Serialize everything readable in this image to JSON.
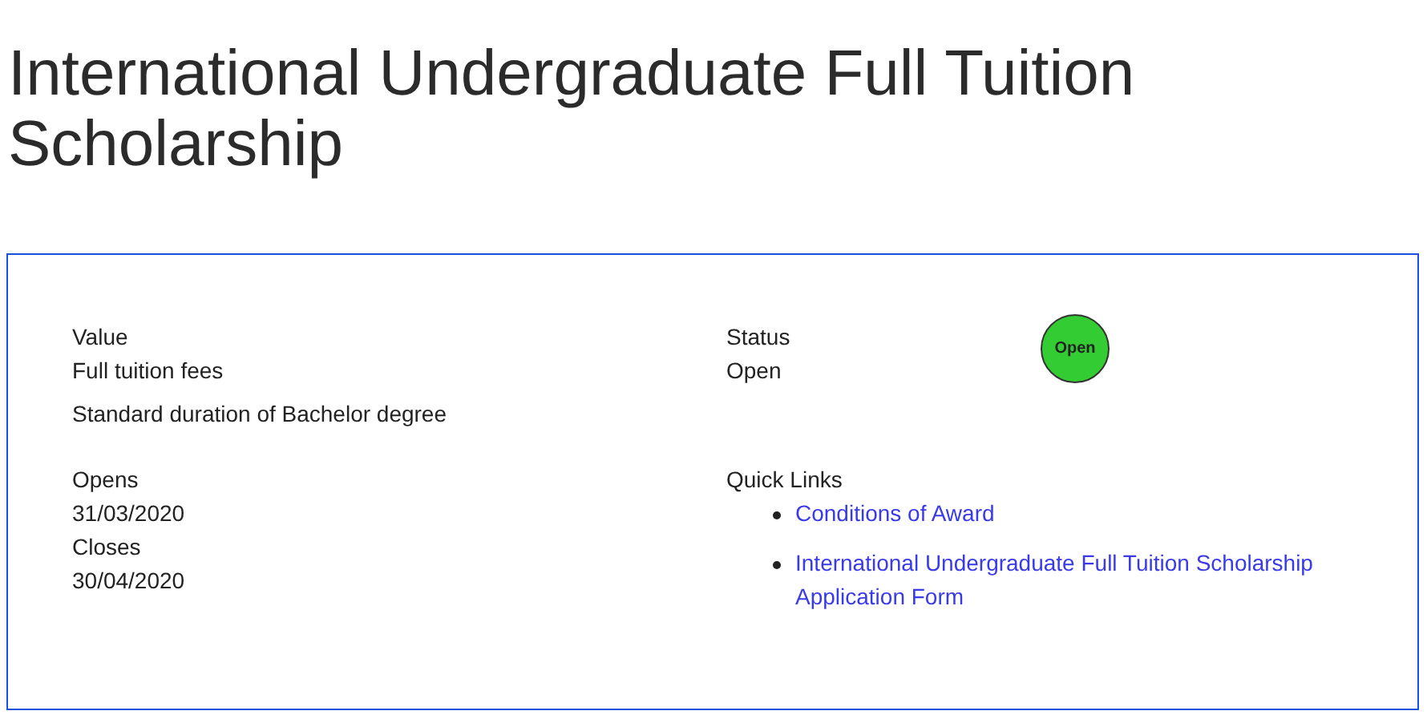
{
  "title": "International Undergraduate Full Tuition Scholarship",
  "value": {
    "label": "Value",
    "lines": [
      "Full tuition fees",
      "Standard duration of Bachelor degree"
    ]
  },
  "dates": [
    {
      "label": "Opens",
      "value": "31/03/2020"
    },
    {
      "label": "Closes",
      "value": "30/04/2020"
    }
  ],
  "status": {
    "label": "Status",
    "value": "Open",
    "badge": {
      "text": "Open",
      "color": "#33cc33"
    }
  },
  "quick_links": {
    "label": "Quick Links",
    "links": [
      "Conditions of Award",
      "International Undergraduate Full Tuition Scholarship Application Form"
    ]
  }
}
